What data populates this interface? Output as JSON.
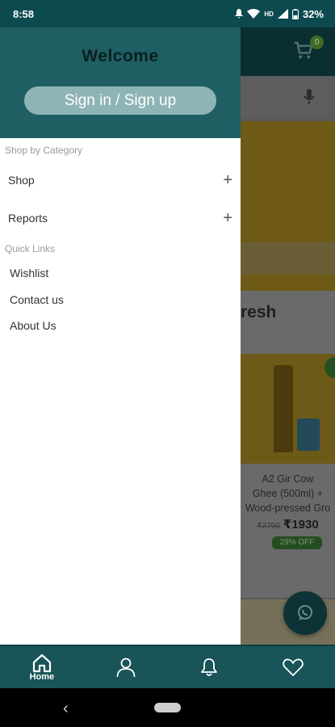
{
  "status_bar": {
    "time": "8:58",
    "battery": "32%"
  },
  "background": {
    "cart_count": "0",
    "section_title_partial": "resh",
    "product": {
      "name_lines": [
        "A2 Gir Cow",
        "Ghee (500ml) +",
        "Wood-pressed Gro"
      ],
      "old_price": "₹2700",
      "new_price": "₹1930",
      "discount": "29% OFF"
    }
  },
  "drawer": {
    "welcome": "Welcome",
    "signin_label": "Sign in / Sign up",
    "category_section": "Shop by Category",
    "categories": [
      {
        "label": "Shop",
        "expand": "+"
      },
      {
        "label": "Reports",
        "expand": "+"
      }
    ],
    "quick_links_section": "Quick Links",
    "quick_links": [
      "Wishlist",
      "Contact us",
      "About Us"
    ]
  },
  "bottom_nav": {
    "home_label": "Home"
  },
  "colors": {
    "primary": "#1f5f63",
    "nav_bar": "#185458",
    "signin_button": "#8fb4b7"
  }
}
